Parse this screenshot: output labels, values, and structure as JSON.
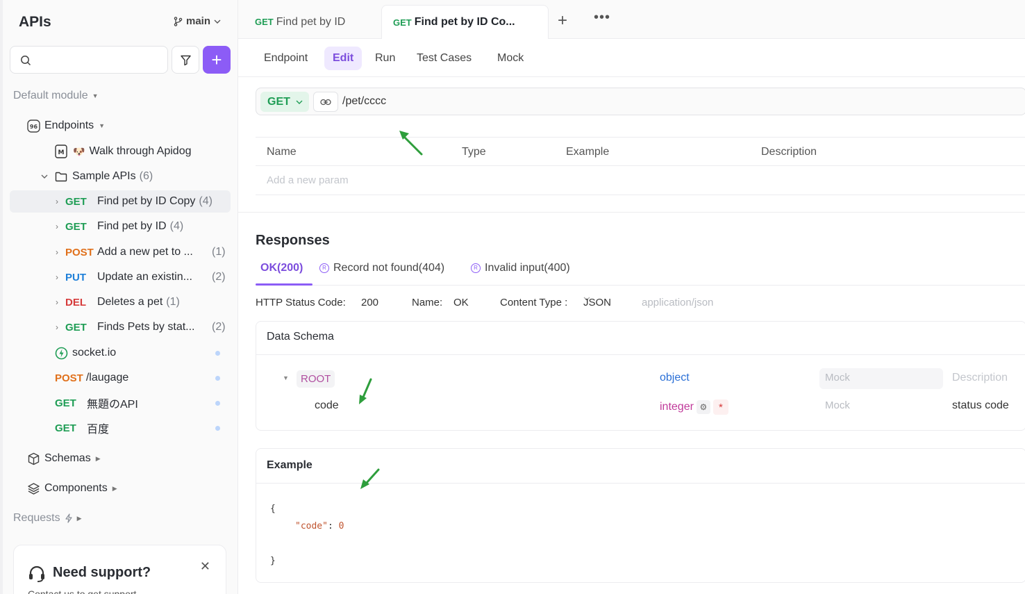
{
  "sidebar": {
    "title": "APIs",
    "branch": "main",
    "search_placeholder": "",
    "default_module": "Default module",
    "endpoints_label": "Endpoints",
    "walkthrough": "Walk through Apidog",
    "walkthrough_emoji": "🐶",
    "folder": {
      "label": "Sample APIs",
      "count": "(6)"
    },
    "items": [
      {
        "method": "GET",
        "label": "Find pet by ID Copy",
        "count": "(4)"
      },
      {
        "method": "GET",
        "label": "Find pet by ID",
        "count": "(4)"
      },
      {
        "method": "POST",
        "label": "Add a new pet to ...",
        "count": "(1)"
      },
      {
        "method": "PUT",
        "label": "Update an existin...",
        "count": "(2)"
      },
      {
        "method": "DEL",
        "label": "Deletes a pet",
        "count": "(1)"
      },
      {
        "method": "GET",
        "label": "Finds Pets by stat...",
        "count": "(2)"
      }
    ],
    "socket": "socket.io",
    "extra": [
      {
        "method": "POST",
        "label": "/laugage"
      },
      {
        "method": "GET",
        "label": "無題のAPI"
      },
      {
        "method": "GET",
        "label": "百度"
      }
    ],
    "schemas": "Schemas",
    "components": "Components",
    "requests": "Requests",
    "support": {
      "title": "Need support?",
      "subtitle": "Contact us to get support"
    }
  },
  "tabs": [
    {
      "method": "GET",
      "label": "Find pet by ID"
    },
    {
      "method": "GET",
      "label": "Find pet by ID Co..."
    }
  ],
  "subtabs": [
    "Endpoint",
    "Edit",
    "Run",
    "Test Cases",
    "Mock"
  ],
  "url": {
    "method": "GET",
    "path": "/pet/cccc"
  },
  "params": {
    "headers": [
      "Name",
      "Type",
      "Example",
      "Description"
    ],
    "add_placeholder": "Add a new param"
  },
  "responses": {
    "title": "Responses",
    "tabs": [
      "OK(200)",
      "Record not found(404)",
      "Invalid input(400)"
    ],
    "status_label": "HTTP Status Code:",
    "status_value": "200",
    "name_label": "Name:",
    "name_value": "OK",
    "content_type_label": "Content Type :",
    "content_type_value": "JSON",
    "content_type_mime": "application/json"
  },
  "schema": {
    "title": "Data Schema",
    "root": {
      "name": "ROOT",
      "type": "object",
      "mock": "Mock",
      "desc": "Description"
    },
    "field": {
      "name": "code",
      "type": "integer",
      "mock": "Mock",
      "desc": "status code",
      "required_mark": "*"
    }
  },
  "example": {
    "title": "Example",
    "open": "{",
    "key": "\"code\"",
    "sep": ": ",
    "value": "0",
    "close": "}"
  },
  "colors": {
    "accent": "#8c5cf6",
    "get": "#1f9d55",
    "post": "#e0701b",
    "put": "#1e7fd8",
    "del": "#d63b3b",
    "arrow": "#2e9e3c"
  }
}
